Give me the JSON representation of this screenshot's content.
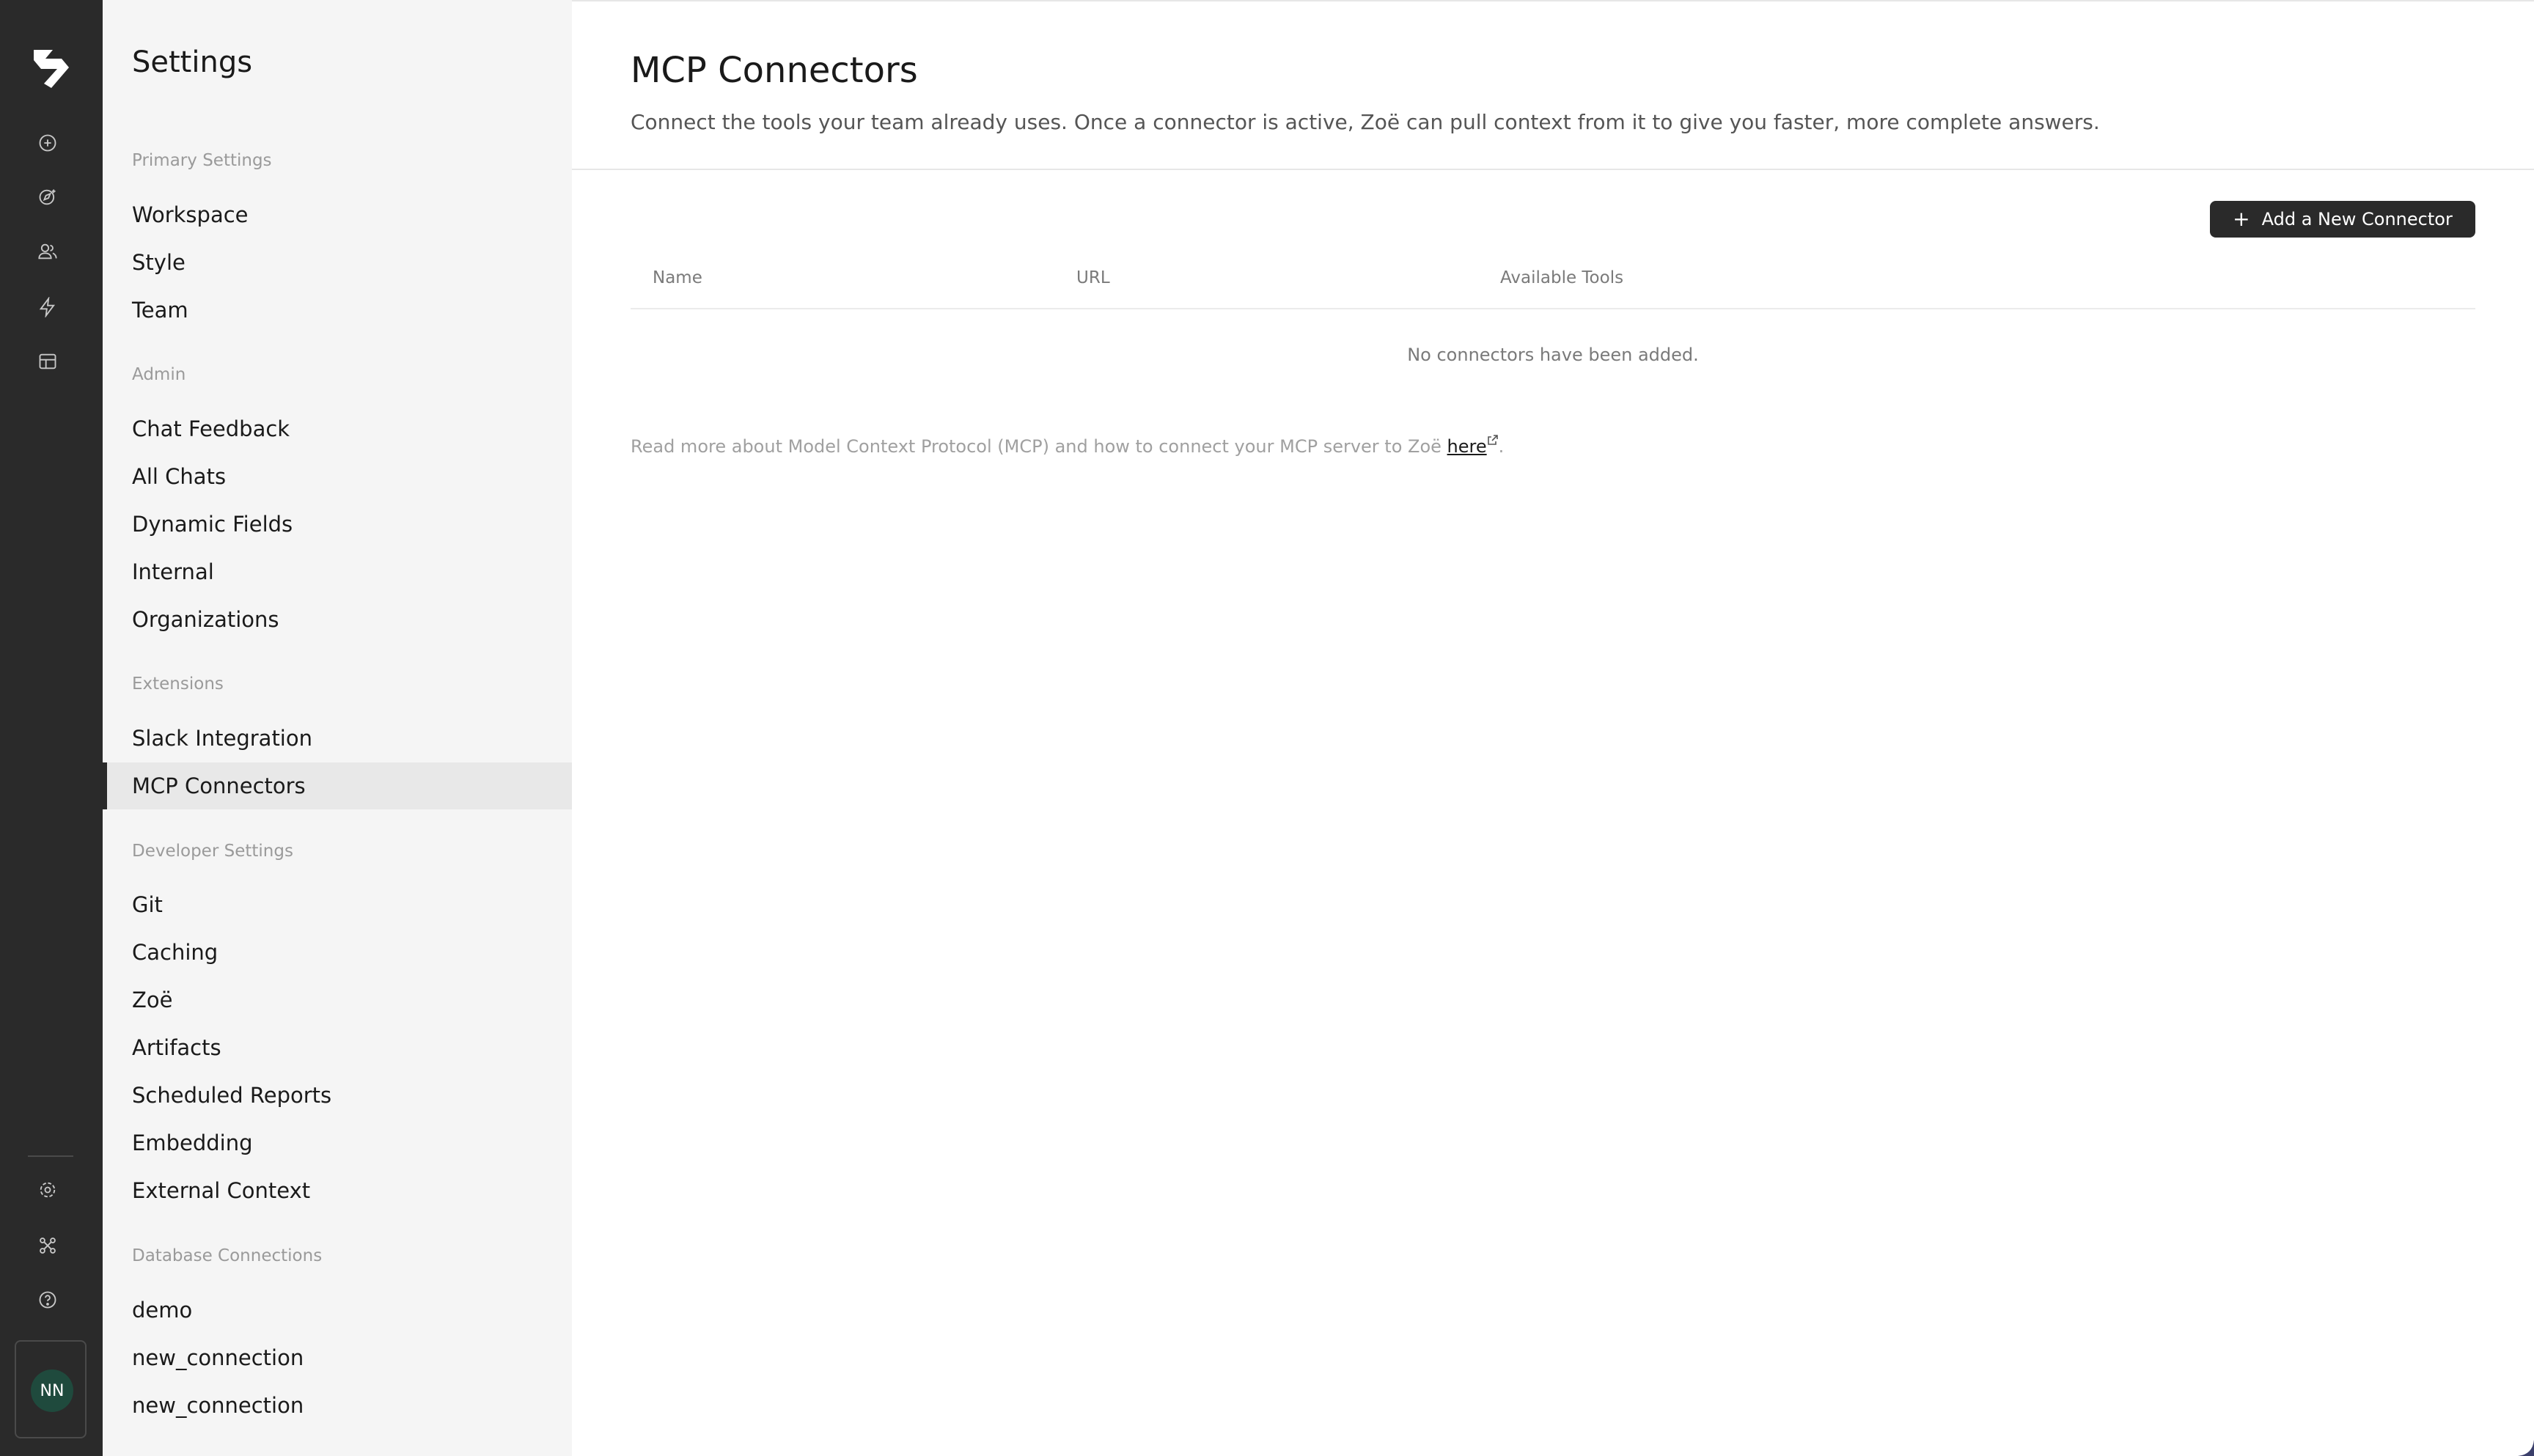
{
  "rail": {
    "user_initials": "NN",
    "colors": {
      "background": "#2a2a2a",
      "avatar": "#1f4a3d"
    }
  },
  "sidebar": {
    "title": "Settings",
    "sections": [
      {
        "label": "Primary Settings",
        "items": [
          "Workspace",
          "Style",
          "Team"
        ]
      },
      {
        "label": "Admin",
        "items": [
          "Chat Feedback",
          "All Chats",
          "Dynamic Fields",
          "Internal",
          "Organizations"
        ]
      },
      {
        "label": "Extensions",
        "items": [
          "Slack Integration",
          "MCP Connectors"
        ]
      },
      {
        "label": "Developer Settings",
        "items": [
          "Git",
          "Caching",
          "Zoë",
          "Artifacts",
          "Scheduled Reports",
          "Embedding",
          "External Context"
        ]
      },
      {
        "label": "Database Connections",
        "items": [
          "demo",
          "new_connection",
          "new_connection"
        ]
      }
    ],
    "active_item": "MCP Connectors"
  },
  "main": {
    "title": "MCP Connectors",
    "description": "Connect the tools your team already uses. Once a connector is active, Zoë can pull context from it to give you faster, more complete answers.",
    "add_button_label": "Add a New Connector",
    "table": {
      "columns": [
        "Name",
        "URL",
        "Available Tools"
      ],
      "empty_text": "No connectors have been added."
    },
    "footnote_text": "Read more about Model Context Protocol (MCP) and how to connect your MCP server to Zoë ",
    "footnote_link": "here",
    "footnote_end": "."
  },
  "icons": [
    "logo-icon",
    "new-chat-icon",
    "explore-icon",
    "users-icon",
    "bolt-icon",
    "layout-icon",
    "settings-icon",
    "integrations-icon",
    "help-icon",
    "plus-icon",
    "external-link-icon"
  ]
}
